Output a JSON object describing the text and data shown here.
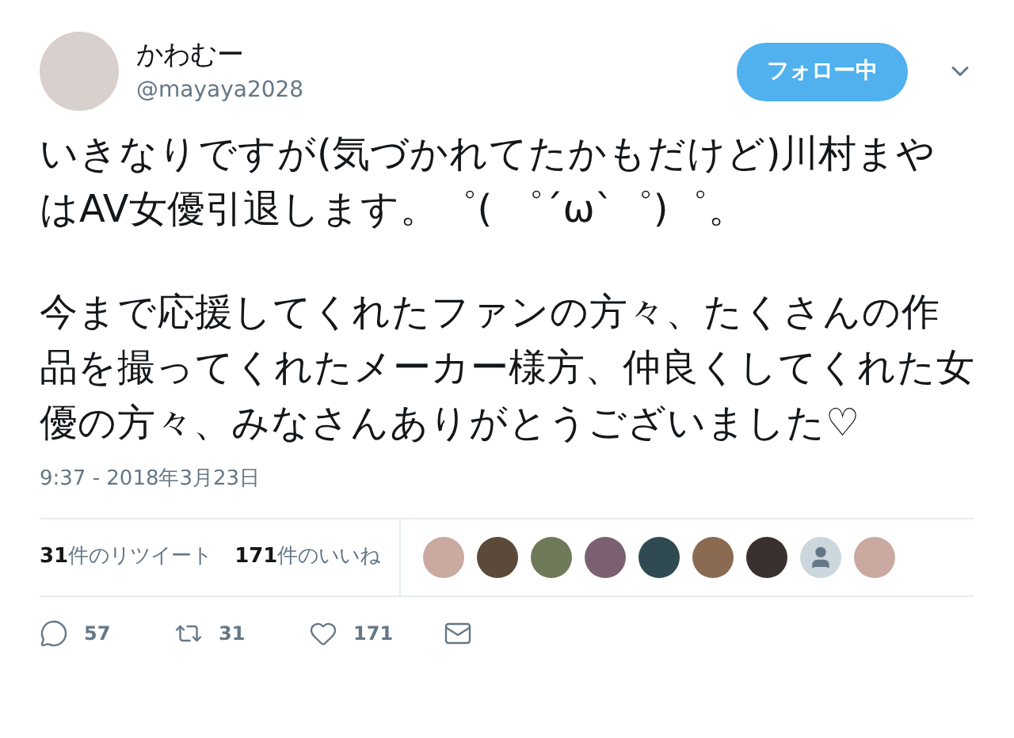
{
  "user": {
    "name": "かわむー",
    "handle": "@mayaya2028"
  },
  "follow_button": {
    "label": "フォロー中"
  },
  "tweet": {
    "paragraphs": [
      "いきなりですが(気づかれてたかもだけど)川村まやはAV女優引退します。゜( ゜´ω`゜)゜。",
      "今まで応援してくれたファンの方々、たくさんの作品を撮ってくれたメーカー様方、仲良くしてくれた女優の方々、みなさんありがとうございました♡"
    ],
    "timestamp": "9:37 - 2018年3月23日"
  },
  "stats": [
    {
      "count": "31",
      "label": "件のリツイート"
    },
    {
      "count": "171",
      "label": "件のいいね"
    }
  ],
  "likers": [
    {
      "kind": "photo"
    },
    {
      "kind": "photo"
    },
    {
      "kind": "photo"
    },
    {
      "kind": "photo"
    },
    {
      "kind": "photo"
    },
    {
      "kind": "photo"
    },
    {
      "kind": "photo"
    },
    {
      "kind": "default"
    },
    {
      "kind": "photo"
    }
  ],
  "actions": [
    {
      "kind": "reply",
      "count": "57"
    },
    {
      "kind": "retweet",
      "count": "31"
    },
    {
      "kind": "like",
      "count": "171"
    },
    {
      "kind": "message"
    }
  ]
}
